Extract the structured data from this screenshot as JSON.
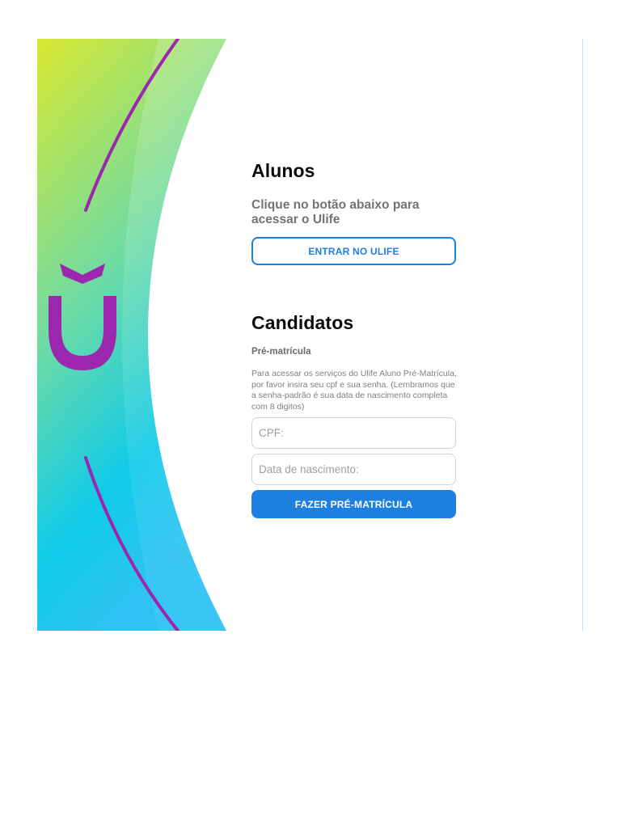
{
  "brand": {
    "logo_text": "U",
    "colors": {
      "gradient_top": "#d7e733",
      "gradient_mid": "#7de2a6",
      "gradient_bottom": "#12c9ea",
      "arc": "#9b27af",
      "logo": "#9b27af",
      "primary": "#1d7fe0"
    }
  },
  "alunos": {
    "title": "Alunos",
    "lead": "Clique no botão abaixo para acessar o Ulife",
    "button_label": "ENTRAR NO ULIFE"
  },
  "candidatos": {
    "title": "Candidatos",
    "subtitle": "Pré-matrícula",
    "description": "Para acessar os serviços do Ulife Aluno Pré-Matrícula, por favor insira seu cpf e sua senha. (Lembramos que a senha-padrão é sua data de nascimento completa com 8 digitos)",
    "cpf_placeholder": "CPF:",
    "birthdate_placeholder": "Data de nascimento:",
    "button_label": "FAZER PRÉ-MATRÍCULA"
  }
}
